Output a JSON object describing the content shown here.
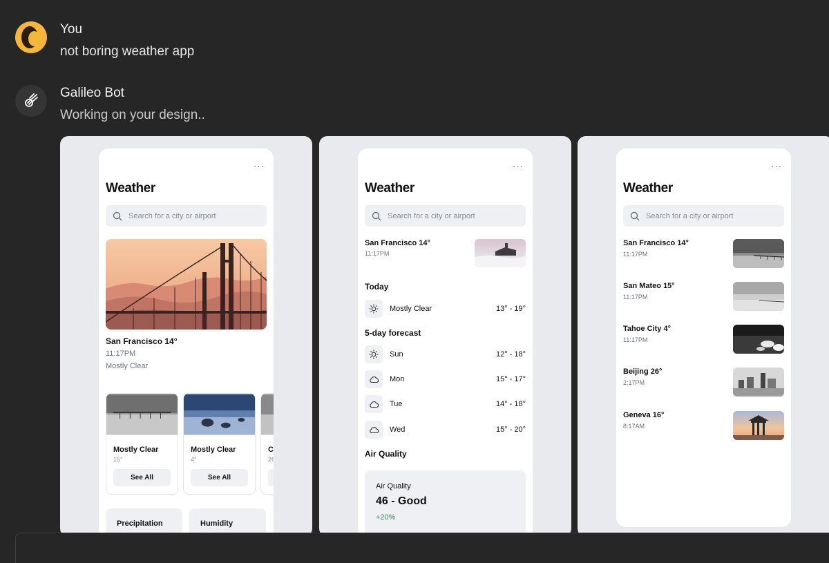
{
  "chat": {
    "user": {
      "name": "You",
      "message": "not boring weather app",
      "avatar_icon": "user-avatar"
    },
    "bot": {
      "name": "Galileo Bot",
      "message": "Working on your design..",
      "avatar_icon": "comet-icon"
    }
  },
  "app": {
    "title": "Weather",
    "menu_label": "···",
    "search_placeholder": "Search for a city or airport"
  },
  "design1": {
    "city": "San Francisco 14°",
    "time": "11:17PM",
    "condition": "Mostly Clear",
    "cards": [
      {
        "condition": "Mostly Clear",
        "temp": "15°",
        "button": "See All"
      },
      {
        "condition": "Mostly Clear",
        "temp": "4°",
        "button": "See All"
      },
      {
        "condition": "Cl",
        "temp": "26",
        "button": ""
      }
    ],
    "stats": [
      "Precipitation",
      "Humidity"
    ]
  },
  "design2": {
    "city": "San Francisco 14°",
    "time": "11:17PM",
    "today_label": "Today",
    "today": {
      "condition": "Mostly Clear",
      "range": "13° - 19°"
    },
    "forecast_label": "5-day forecast",
    "forecast": [
      {
        "day": "Sun",
        "range": "12° - 18°",
        "icon": "sun-icon"
      },
      {
        "day": "Mon",
        "range": "15° - 17°",
        "icon": "cloud-icon"
      },
      {
        "day": "Tue",
        "range": "14° - 18°",
        "icon": "cloud-icon"
      },
      {
        "day": "Wed",
        "range": "15° - 20°",
        "icon": "cloud-icon"
      }
    ],
    "air_quality_label": "Air Quality",
    "air_quality": {
      "label": "Air Quality",
      "value": "46 - Good",
      "delta": "+20%"
    }
  },
  "design3": {
    "cities": [
      {
        "city": "San Francisco 14°",
        "time": "11:17PM"
      },
      {
        "city": "San Mateo 15°",
        "time": "11:17PM"
      },
      {
        "city": "Tahoe City 4°",
        "time": "11:17PM"
      },
      {
        "city": "Beijing 26°",
        "time": "2:17PM"
      },
      {
        "city": "Geneva 16°",
        "time": "8:17AM"
      }
    ]
  },
  "colors": {
    "background": "#262626",
    "card": "#e8eaee",
    "accent_user": "#f4b63b",
    "positive": "#2e8b57"
  }
}
